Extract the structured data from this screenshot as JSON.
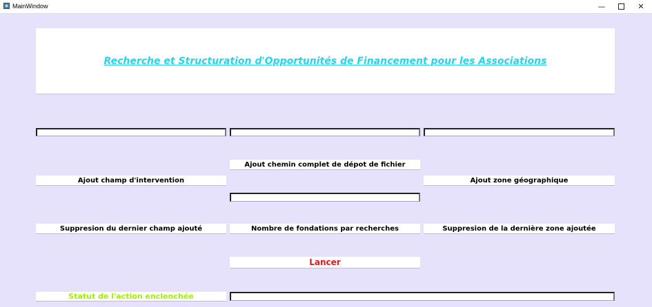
{
  "window": {
    "title": "MainWindow",
    "minimize_glyph": "—",
    "close_glyph": "✕"
  },
  "header": {
    "title": "Recherche et Structuration d'Opportunités de Financement pour les Associations",
    "title_color": "#21d6ee"
  },
  "inputs": {
    "champ_intervention": "",
    "chemin_depot": "",
    "zone_geographique": "",
    "nombre_fondations": "",
    "statut_output": ""
  },
  "buttons": {
    "ajout_champ": "Ajout champ d'intervention",
    "ajout_chemin": "Ajout chemin complet de dépot de fichier",
    "ajout_zone": "Ajout zone géographique",
    "suppression_champ": "Suppresion du dernier champ ajouté",
    "nombre_fondations": "Nombre de fondations par recherches",
    "suppression_zone": "Suppresion de la dernière zone ajoutée",
    "lancer": "Lancer"
  },
  "status": {
    "label": "Statut de l'action enclenchée",
    "label_color": "#a2f000"
  },
  "colors": {
    "background": "#e6e2fb",
    "launch": "#f01414"
  }
}
